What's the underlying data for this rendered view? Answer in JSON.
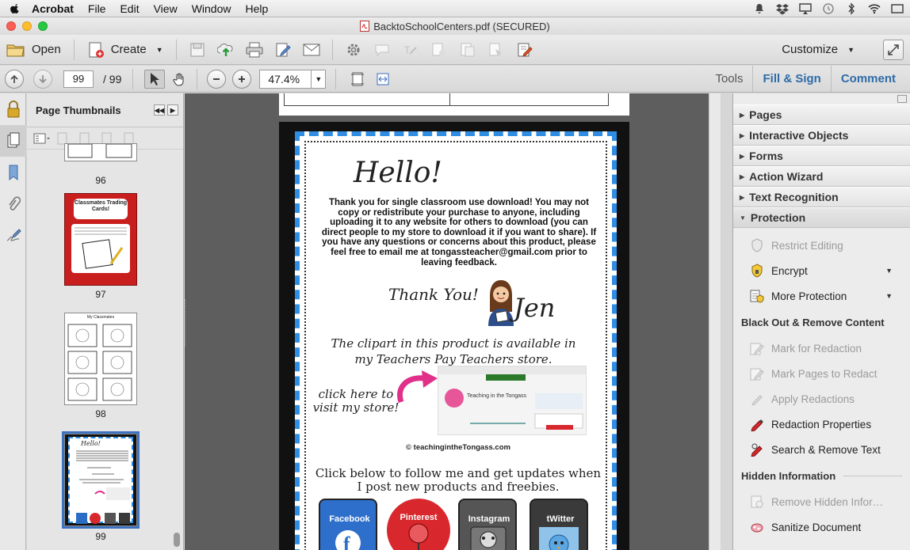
{
  "menubar": {
    "app": "Acrobat",
    "items": [
      "File",
      "Edit",
      "View",
      "Window",
      "Help"
    ]
  },
  "window": {
    "title": "BacktoSchoolCenters.pdf (SECURED)"
  },
  "toolbar": {
    "open_label": "Open",
    "create_label": "Create",
    "customize_label": "Customize"
  },
  "nav": {
    "current_page": "99",
    "page_total": "/ 99",
    "zoom": "47.4%"
  },
  "right_tabs": {
    "tools": "Tools",
    "fill_sign": "Fill & Sign",
    "comment": "Comment"
  },
  "thumbnails": {
    "title": "Page Thumbnails",
    "pages": [
      "96",
      "97",
      "98",
      "99"
    ],
    "thumb97_title": "Classmates Trading Cards!",
    "thumb98_title": "My Classmates",
    "thumb99_title": "Hello!"
  },
  "document": {
    "hello": "Hello!",
    "paragraph": "Thank you for single classroom use download!  You may not copy or redistribute your purchase to anyone, including uploading it to any website for others to download (you can direct people to my store to download it if you want to share). If you have any questions or concerns about this product, please feel free to email me at tongassteacher@gmail.com prior to leaving feedback.",
    "thank_you": "Thank You!",
    "signature": "Jen",
    "clipart": "The clipart in this product is available in my Teachers Pay Teachers store.",
    "click_here": "click here to visit my store!",
    "store_name": "Teaching in the Tongass",
    "copyright": "© teachingintheTongass.com",
    "follow": "Click below to follow me and get updates when I post new products and freebies.",
    "social": [
      "Facebook",
      "Pinterest",
      "Instagram",
      "tWitter"
    ]
  },
  "panel": {
    "sections": [
      "Pages",
      "Interactive Objects",
      "Forms",
      "Action Wizard",
      "Text Recognition",
      "Protection"
    ],
    "protection_items": [
      "Restrict Editing",
      "Encrypt",
      "More Protection"
    ],
    "black_out_header": "Black Out & Remove Content",
    "black_out_items": [
      "Mark for Redaction",
      "Mark Pages to Redact",
      "Apply Redactions",
      "Redaction Properties",
      "Search & Remove Text"
    ],
    "hidden_header": "Hidden Information",
    "hidden_items": [
      "Remove Hidden Infor…",
      "Sanitize Document"
    ]
  },
  "colors": {
    "accent": "#2e6ba8",
    "page_border": "#2f8de4"
  }
}
